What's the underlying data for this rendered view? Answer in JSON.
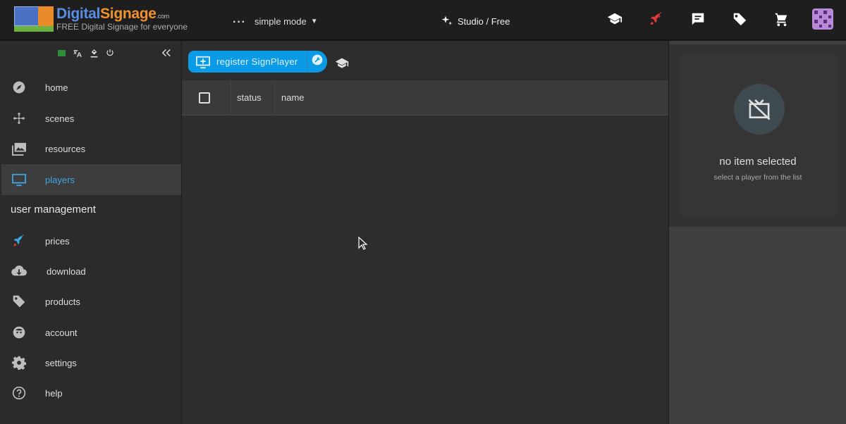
{
  "header": {
    "logo_title_part1": "Digital",
    "logo_title_part2": "Signage",
    "logo_com": ".com",
    "logo_subtitle": "FREE Digital Signage for everyone",
    "mode_label": "simple mode",
    "studio_label": "Studio / Free",
    "icons": [
      "graduation-cap-icon",
      "rocket-icon",
      "chat-icon",
      "tag-icon",
      "cart-icon",
      "avatar"
    ]
  },
  "sidebar": {
    "tools": [
      "monitor-status-icon",
      "translate-icon",
      "theme-icon",
      "power-icon"
    ],
    "items": [
      {
        "label": "home",
        "icon": "compass-icon"
      },
      {
        "label": "scenes",
        "icon": "move-icon"
      },
      {
        "label": "resources",
        "icon": "images-icon"
      },
      {
        "label": "players",
        "icon": "monitor-icon",
        "active": true
      },
      {
        "label": "prices",
        "icon": "rocket-icon"
      },
      {
        "label": "download",
        "icon": "cloud-download-icon"
      },
      {
        "label": "products",
        "icon": "tag-icon"
      },
      {
        "label": "account",
        "icon": "face-icon"
      },
      {
        "label": "settings",
        "icon": "gear-icon"
      },
      {
        "label": "help",
        "icon": "help-icon"
      }
    ],
    "section_label": "user management"
  },
  "main": {
    "register_button": "register SignPlayer",
    "columns": [
      "status",
      "name"
    ]
  },
  "detail": {
    "title": "no item selected",
    "subtitle": "select a player from the list"
  },
  "colors": {
    "accent": "#0b9ae6",
    "active_text": "#3ea6e0",
    "rocket": "#e53935"
  }
}
